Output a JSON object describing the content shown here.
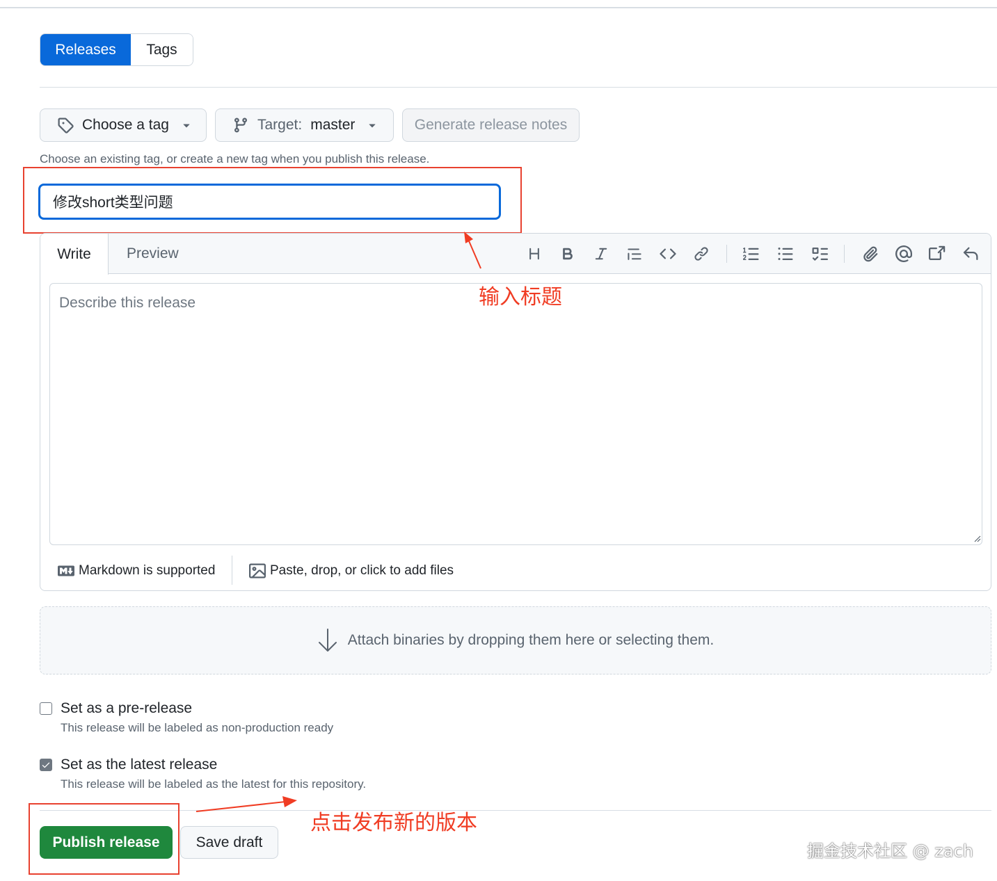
{
  "tabs": {
    "releases": "Releases",
    "tags": "Tags",
    "active": "Releases"
  },
  "toolbar": {
    "choose_tag": "Choose a tag",
    "target_label": "Target:",
    "target_value": "master",
    "generate_notes": "Generate release notes"
  },
  "tag_hint": "Choose an existing tag, or create a new tag when you publish this release.",
  "title_input": {
    "value": "修改short类型问题"
  },
  "editor": {
    "tab_write": "Write",
    "tab_preview": "Preview",
    "active_tab": "Write",
    "placeholder": "Describe this release",
    "format_icons": [
      "heading-icon",
      "bold-icon",
      "italic-icon",
      "quote-icon",
      "code-icon",
      "link-icon",
      "ordered-list-icon",
      "unordered-list-icon",
      "task-list-icon",
      "attach-icon",
      "mention-icon",
      "reference-icon",
      "undo-icon"
    ],
    "markdown_note": "Markdown is supported",
    "files_note": "Paste, drop, or click to add files"
  },
  "dropzone": {
    "text": "Attach binaries by dropping them here or selecting them."
  },
  "options": {
    "prerelease": {
      "label": "Set as a pre-release",
      "description": "This release will be labeled as non-production ready",
      "checked": false
    },
    "latest": {
      "label": "Set as the latest release",
      "description": "This release will be labeled as the latest for this repository.",
      "checked": true
    }
  },
  "actions": {
    "publish": "Publish release",
    "save_draft": "Save draft"
  },
  "annotations": {
    "title_note": "输入标题",
    "publish_note": "点击发布新的版本",
    "color": "#f03c23"
  },
  "watermark": "掘金技术社区 @ zach",
  "colors": {
    "primary": "#0969da",
    "publish": "#1f883d",
    "annotation": "#e8412f"
  }
}
